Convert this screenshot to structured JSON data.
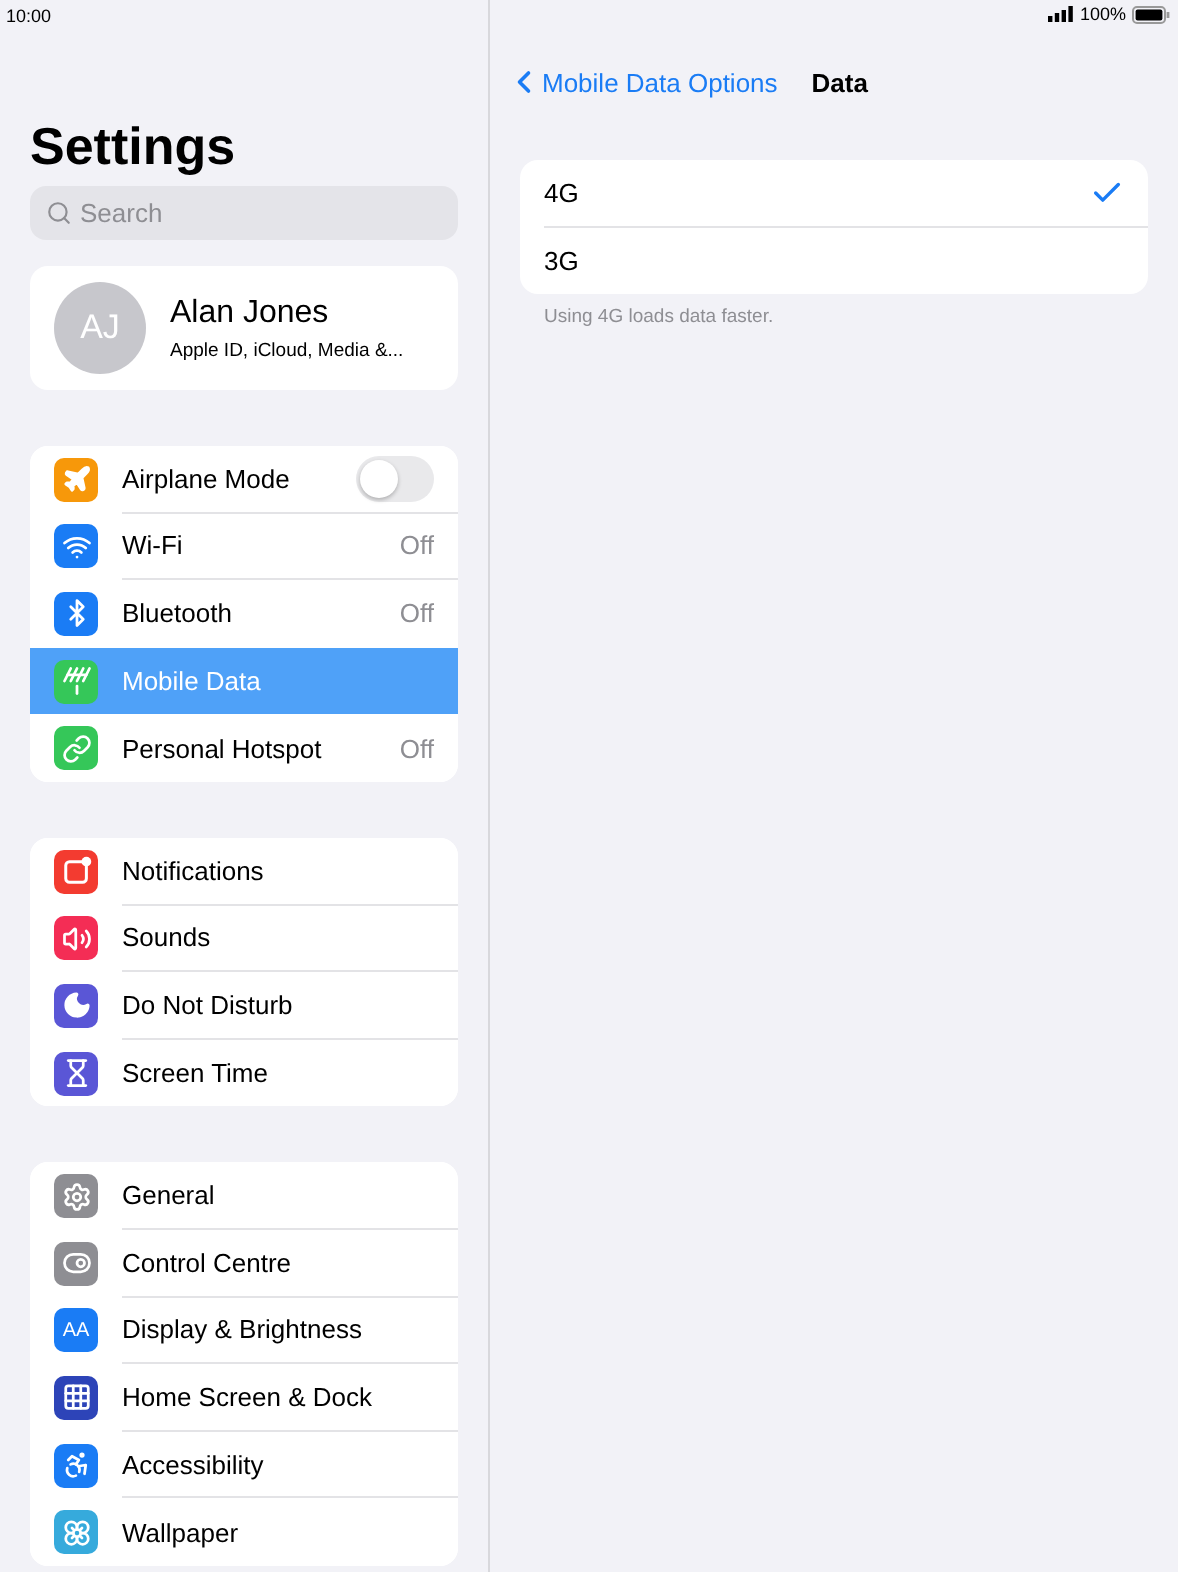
{
  "status_bar": {
    "time": "10:00",
    "battery": "100%"
  },
  "sidebar": {
    "title": "Settings",
    "search": {
      "placeholder": "Search"
    },
    "profile": {
      "initials": "AJ",
      "name": "Alan Jones",
      "subtitle": "Apple ID, iCloud, Media &..."
    },
    "sections": [
      {
        "items": [
          {
            "label": "Airplane Mode",
            "color": "#f7980a",
            "kind": "toggle",
            "on": false,
            "selected": false
          },
          {
            "label": "Wi-Fi",
            "color": "#1a7cf5",
            "kind": "value",
            "value": "Off",
            "selected": false
          },
          {
            "label": "Bluetooth",
            "color": "#1a7cf5",
            "kind": "value",
            "value": "Off",
            "selected": false
          },
          {
            "label": "Mobile Data",
            "color": "#35c759",
            "kind": "plain",
            "selected": true
          },
          {
            "label": "Personal Hotspot",
            "color": "#35c759",
            "kind": "value",
            "value": "Off",
            "selected": false
          }
        ]
      },
      {
        "items": [
          {
            "label": "Notifications",
            "color": "#f33b30",
            "kind": "plain",
            "selected": false
          },
          {
            "label": "Sounds",
            "color": "#f42d55",
            "kind": "plain",
            "selected": false
          },
          {
            "label": "Do Not Disturb",
            "color": "#5a56d6",
            "kind": "plain",
            "selected": false
          },
          {
            "label": "Screen Time",
            "color": "#5a56d6",
            "kind": "plain",
            "selected": false
          }
        ]
      },
      {
        "items": [
          {
            "label": "General",
            "color": "#8e8e93",
            "kind": "plain",
            "selected": false
          },
          {
            "label": "Control Centre",
            "color": "#8e8e93",
            "kind": "plain",
            "selected": false
          },
          {
            "label": "Display & Brightness",
            "glyph": "AA",
            "color": "#1a7cf5",
            "kind": "plain",
            "selected": false
          },
          {
            "label": "Home Screen & Dock",
            "color": "#2d44b8",
            "kind": "plain",
            "selected": false
          },
          {
            "label": "Accessibility",
            "color": "#1a7cf5",
            "kind": "plain",
            "selected": false
          },
          {
            "label": "Wallpaper",
            "color": "#36aadc",
            "kind": "plain",
            "selected": false
          }
        ]
      }
    ]
  },
  "detail": {
    "back": "Mobile Data Options",
    "title": "Data",
    "options": [
      {
        "label": "4G",
        "selected": true
      },
      {
        "label": "3G",
        "selected": false
      }
    ],
    "footer": "Using 4G loads data faster."
  }
}
